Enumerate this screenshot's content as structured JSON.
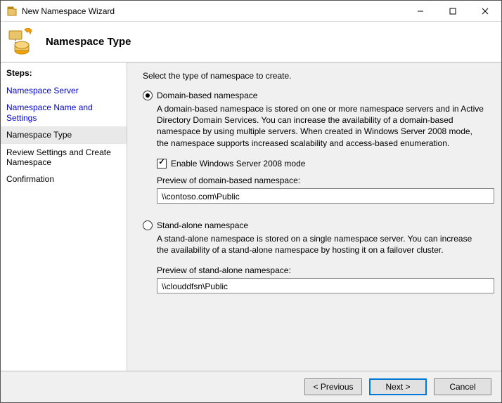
{
  "window": {
    "title": "New Namespace Wizard"
  },
  "header": {
    "title": "Namespace Type"
  },
  "sidebar": {
    "heading": "Steps:",
    "items": [
      {
        "label": "Namespace Server",
        "state": "link"
      },
      {
        "label": "Namespace Name and Settings",
        "state": "link"
      },
      {
        "label": "Namespace Type",
        "state": "current"
      },
      {
        "label": "Review Settings and Create Namespace",
        "state": "future"
      },
      {
        "label": "Confirmation",
        "state": "future"
      }
    ]
  },
  "main": {
    "instruction": "Select the type of namespace to create.",
    "option_domain": {
      "label": "Domain-based namespace",
      "selected": true,
      "description": "A domain-based namespace is stored on one or more namespace servers and in Active Directory Domain Services. You can increase the availability of a domain-based namespace by using multiple servers. When created in Windows Server 2008 mode, the namespace supports increased scalability and access-based enumeration.",
      "checkbox_label": "Enable Windows Server 2008 mode",
      "checkbox_checked": true,
      "preview_label": "Preview of domain-based namespace:",
      "preview_value": "\\\\contoso.com\\Public"
    },
    "option_standalone": {
      "label": "Stand-alone namespace",
      "selected": false,
      "description": "A stand-alone namespace is stored on a single namespace server. You can increase the availability of a stand-alone namespace by hosting it on a failover cluster.",
      "preview_label": "Preview of stand-alone namespace:",
      "preview_value": "\\\\clouddfsn\\Public"
    }
  },
  "footer": {
    "previous": "< Previous",
    "next": "Next >",
    "cancel": "Cancel"
  }
}
